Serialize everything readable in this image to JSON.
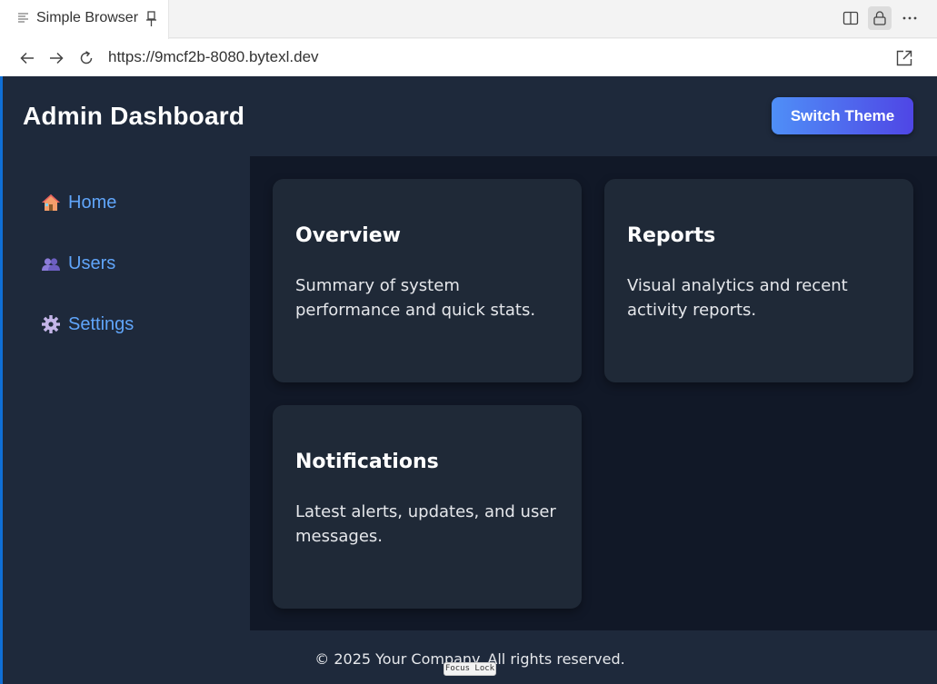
{
  "tab": {
    "title": "Simple Browser"
  },
  "navbar": {
    "url": "https://9mcf2b-8080.bytexl.dev"
  },
  "app": {
    "title": "Admin Dashboard",
    "theme_button": "Switch Theme"
  },
  "sidebar": {
    "items": [
      {
        "label": "Home",
        "icon": "house-icon"
      },
      {
        "label": "Users",
        "icon": "users-icon"
      },
      {
        "label": "Settings",
        "icon": "gear-icon"
      }
    ]
  },
  "cards": [
    {
      "title": "Overview",
      "text": "Summary of system performance and quick stats."
    },
    {
      "title": "Reports",
      "text": "Visual analytics and recent activity reports."
    },
    {
      "title": "Notifications",
      "text": "Latest alerts, updates, and user messages."
    }
  ],
  "footer": {
    "text": "© 2025 Your Company. All rights reserved."
  },
  "overlay": {
    "focus_lock": "Focus Lock"
  },
  "colors": {
    "page_bg": "#111827",
    "panel_bg": "#1e293b",
    "card_bg": "#1f2937",
    "link": "#60a5fa",
    "button_gradient_start": "#4f8ff7",
    "button_gradient_end": "#4f46e5"
  }
}
